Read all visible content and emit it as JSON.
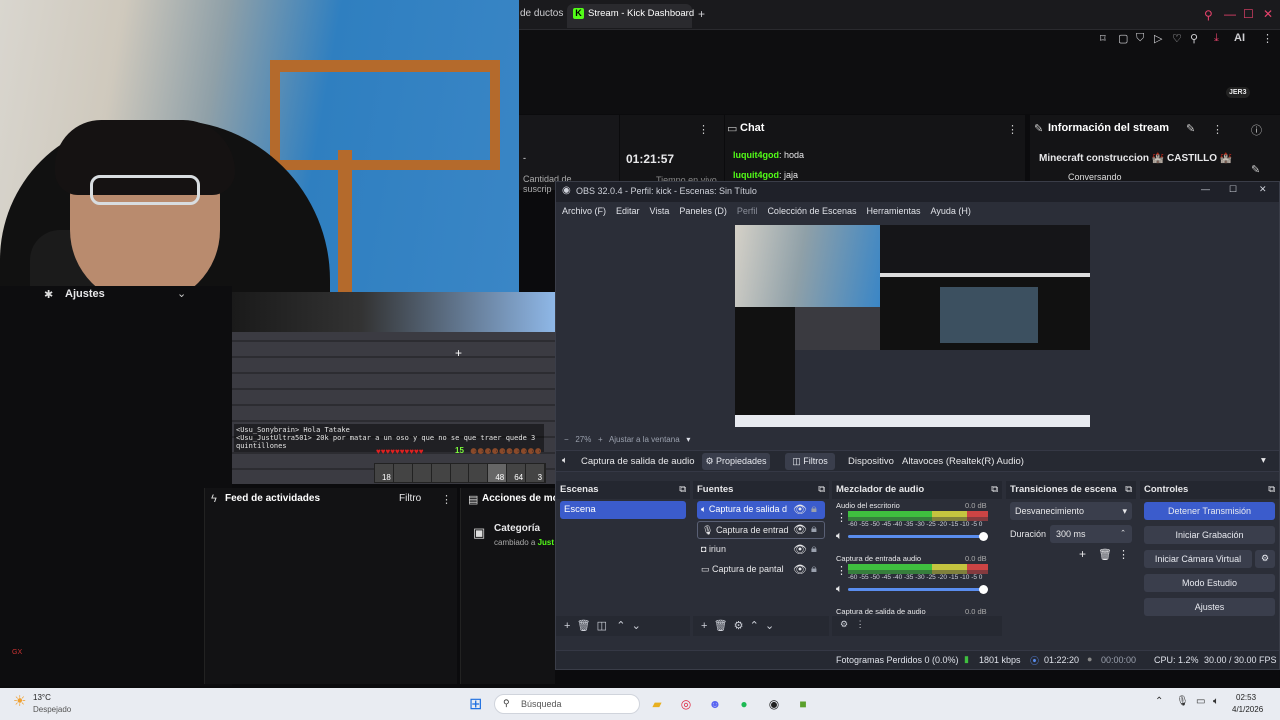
{
  "browser": {
    "tab_prev": "de ductos",
    "tab_active": "Stream - Kick Dashboard",
    "new_tab": "+",
    "account_badge": "JER3"
  },
  "dashboard": {
    "stat_label": "Cantidad de suscrip",
    "stat_short": "-",
    "timer": "01:21:57",
    "timer_sub": "Tiempo en vivo",
    "chat": {
      "title": "Chat",
      "messages": [
        {
          "user": "luquit4god",
          "text": ": hoda"
        },
        {
          "user": "luquit4god",
          "text": ": jaja"
        }
      ]
    },
    "info": {
      "title": "Información del stream",
      "stream_title": "Minecraft construccion 🏰 CASTILLO 🏰",
      "category": "Conversando"
    },
    "settings_label": "Ajustes",
    "feed": {
      "title": "Feed de actividades",
      "filter": "Filtro"
    },
    "actions": {
      "title": "Acciones de mo",
      "category_label": "Categoría",
      "category_change": "cambiado a",
      "category_user": "Just"
    },
    "gx_label": "GX"
  },
  "minecraft": {
    "chat_lines": [
      "<Usu_Sonybrain> Hola Tatake",
      "<Usu_JustUltra501> 20k por matar a un oso y que no se que traer quede 3 quintillones"
    ],
    "xp_level": "15",
    "hotbar": [
      "18",
      "",
      "",
      "",
      "",
      "",
      "48",
      "64",
      "3"
    ]
  },
  "obs": {
    "title": "OBS 32.0.4 - Perfil: kick - Escenas: Sin Título",
    "menu": [
      "Archivo (F)",
      "Editar",
      "Vista",
      "Paneles (D)",
      "Perfil",
      "Colección de Escenas",
      "Herramientas",
      "Ayuda (H)"
    ],
    "zoom": "27%",
    "zoom_mode": "Ajustar a la ventana",
    "selected_source": "Captura de salida de audio",
    "properties": "Propiedades",
    "filters": "Filtros",
    "device_label": "Dispositivo",
    "device_value": "Altavoces (Realtek(R) Audio)",
    "scenes": {
      "title": "Escenas",
      "items": [
        "Escena"
      ]
    },
    "sources": {
      "title": "Fuentes",
      "items": [
        "Captura de salida d",
        "Captura de entrad",
        "iriun",
        "Captura de pantal"
      ]
    },
    "mixer": {
      "title": "Mezclador de audio",
      "scale": "-60 -55 -50 -45 -40 -35 -30 -25 -20 -15 -10 -5  0",
      "channels": [
        {
          "name": "Audio del escritorio",
          "db": "0.0 dB"
        },
        {
          "name": "Captura de entrada audio",
          "db": "0.0 dB"
        },
        {
          "name": "Captura de salida de audio",
          "db": "0.0 dB"
        }
      ]
    },
    "transitions": {
      "title": "Transiciones de escena",
      "type": "Desvanecimiento",
      "duration_label": "Duración",
      "duration_value": "300 ms"
    },
    "controls": {
      "title": "Controles",
      "stop_stream": "Detener Transmisión",
      "start_rec": "Iniciar Grabación",
      "virtual_cam": "Iniciar Cámara Virtual",
      "studio": "Modo Estudio",
      "settings": "Ajustes"
    },
    "status": {
      "dropped": "Fotogramas Perdidos 0 (0.0%)",
      "bitrate": "1801 kbps",
      "live_time": "01:22:20",
      "rec_time": "00:00:00",
      "cpu": "CPU: 1.2%",
      "fps": "30.00 / 30.00 FPS"
    }
  },
  "taskbar": {
    "weather_temp": "13°C",
    "weather_desc": "Despejado",
    "search_placeholder": "Búsqueda",
    "time": "02:53",
    "date": "4/1/2026"
  }
}
